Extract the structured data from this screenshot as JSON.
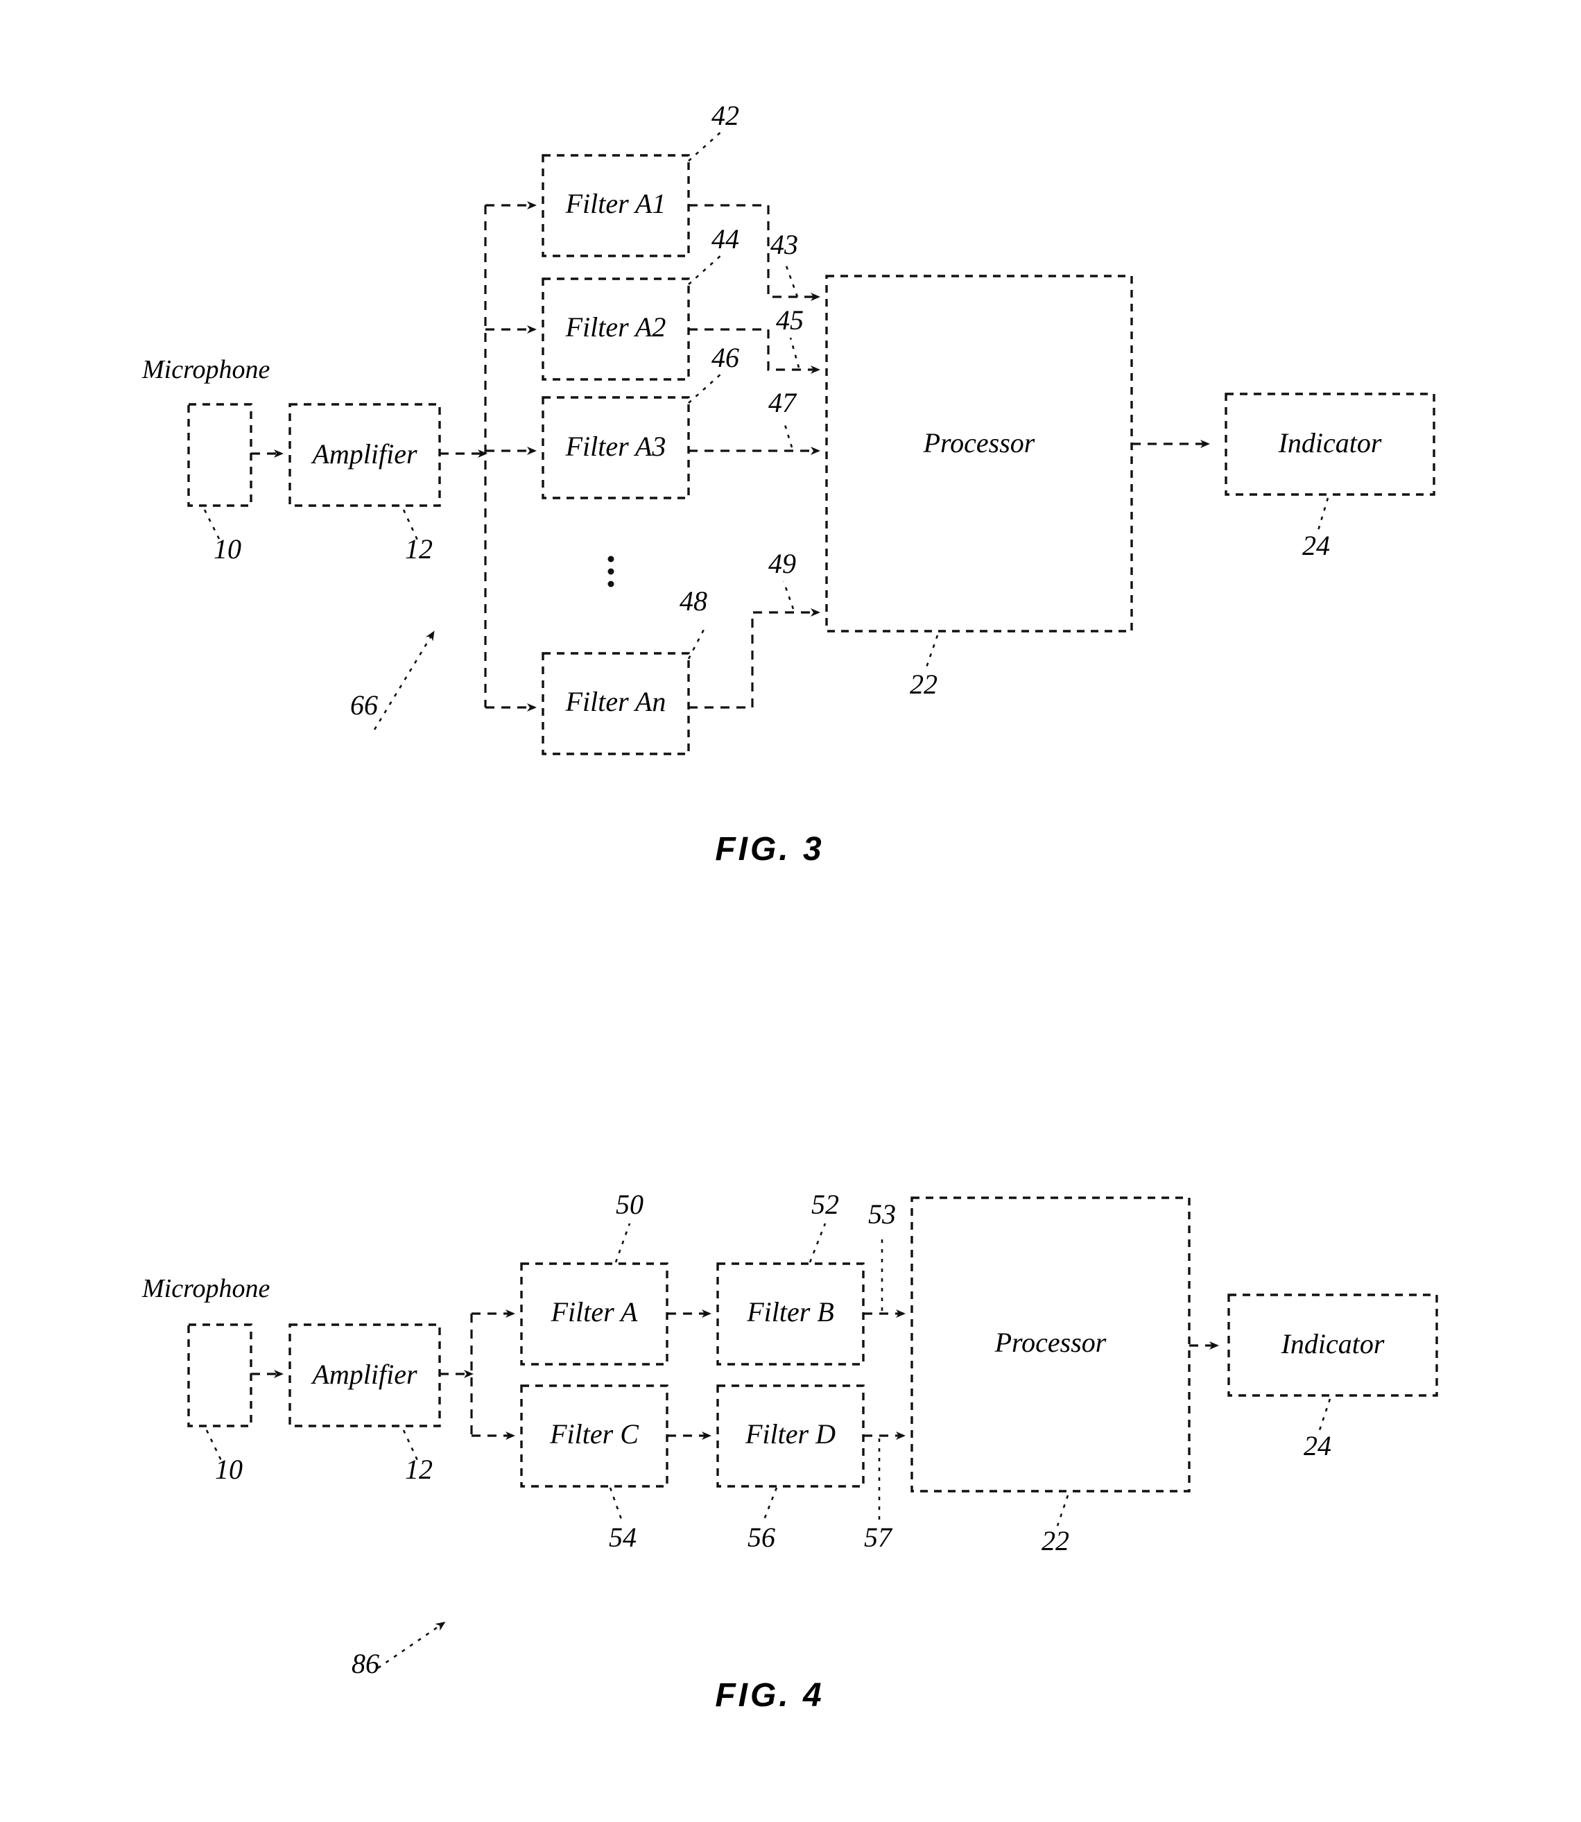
{
  "document": {
    "type": "patent-drawing-sheet",
    "page_background": "#ffffff",
    "line_color": "#111111"
  },
  "figures": [
    {
      "id": "fig3",
      "caption": "FIG. 3",
      "system_ref": "66",
      "input_label": "Microphone",
      "blocks": [
        {
          "name": "microphone",
          "label": "",
          "ref": "10"
        },
        {
          "name": "amplifier",
          "label": "Amplifier",
          "ref": "12"
        },
        {
          "name": "filter-a1",
          "label": "Filter A1",
          "ref": "42"
        },
        {
          "name": "filter-a2",
          "label": "Filter A2",
          "ref": "44"
        },
        {
          "name": "filter-a3",
          "label": "Filter A3",
          "ref": "46"
        },
        {
          "name": "filter-an",
          "label": "Filter An",
          "ref": "48"
        },
        {
          "name": "processor",
          "label": "Processor",
          "ref": "22"
        },
        {
          "name": "indicator",
          "label": "Indicator",
          "ref": "24"
        }
      ],
      "signal_refs": [
        "43",
        "45",
        "47",
        "49"
      ],
      "ellipsis": "⋮"
    },
    {
      "id": "fig4",
      "caption": "FIG. 4",
      "system_ref": "86",
      "input_label": "Microphone",
      "blocks": [
        {
          "name": "microphone",
          "label": "",
          "ref": "10"
        },
        {
          "name": "amplifier",
          "label": "Amplifier",
          "ref": "12"
        },
        {
          "name": "filter-a",
          "label": "Filter A",
          "ref": "50"
        },
        {
          "name": "filter-b",
          "label": "Filter B",
          "ref": "52"
        },
        {
          "name": "filter-c",
          "label": "Filter C",
          "ref": "54"
        },
        {
          "name": "filter-d",
          "label": "Filter D",
          "ref": "56"
        },
        {
          "name": "processor",
          "label": "Processor",
          "ref": "22"
        },
        {
          "name": "indicator",
          "label": "Indicator",
          "ref": "24"
        }
      ],
      "signal_refs": [
        "53",
        "57"
      ]
    }
  ]
}
